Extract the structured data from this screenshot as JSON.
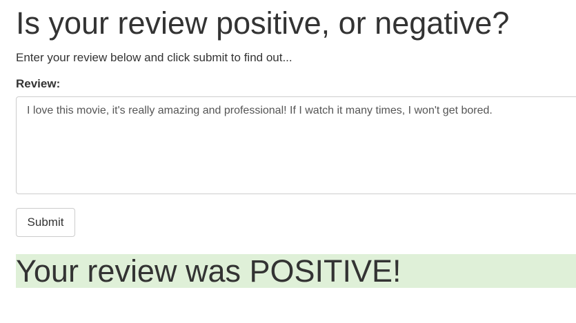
{
  "header": {
    "title": "Is your review positive, or negative?",
    "subtitle": "Enter your review below and click submit to find out..."
  },
  "form": {
    "review_label": "Review:",
    "review_value": "I love this movie, it's really amazing and professional! If I watch it many times, I won't get bored.",
    "submit_label": "Submit"
  },
  "result": {
    "text": "Your review was POSITIVE!",
    "background_color": "#dff0d8"
  }
}
